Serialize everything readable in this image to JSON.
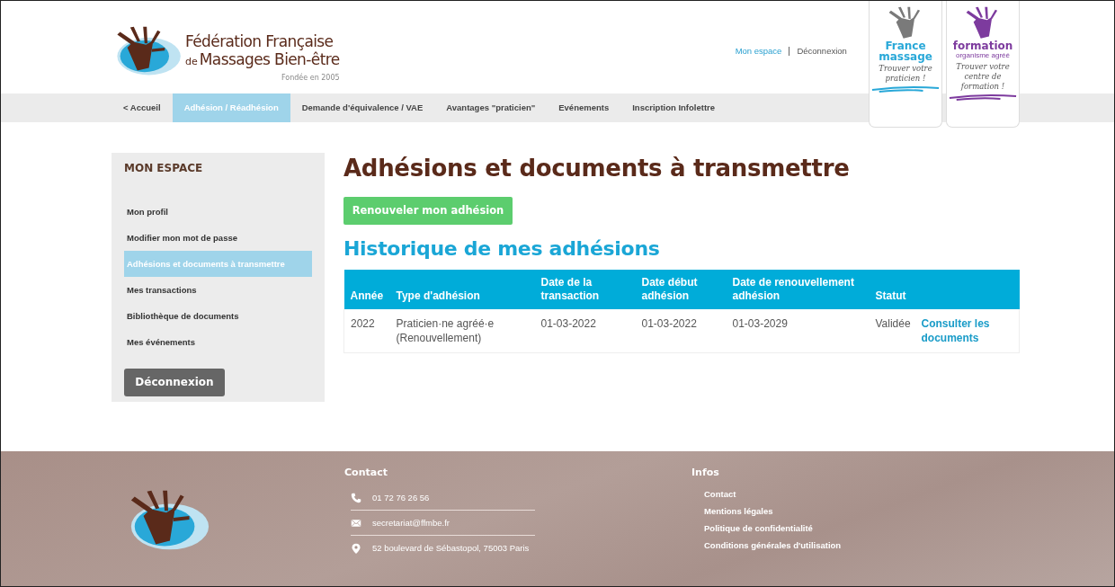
{
  "header": {
    "logo": {
      "line_1": "Fédération Française",
      "line_2_prefix": "de",
      "line_2": "Massages Bien-être",
      "tagline": "Fondée en 2005"
    },
    "user_links": [
      {
        "label": "Mon espace",
        "selected": true
      },
      {
        "label": "Déconnexion",
        "selected": false
      }
    ],
    "promo_cards": [
      {
        "title": "France",
        "title_2": "massage",
        "slogan": "Trouver votre praticien !",
        "color": "#29a8d8"
      },
      {
        "title": "formation",
        "subtitle": "organisme agréé",
        "slogan": "Trouver votre centre de formation !",
        "color": "#7d3b9e"
      }
    ]
  },
  "nav": {
    "items": [
      {
        "label": "< Accueil",
        "selected": false
      },
      {
        "label": "Adhésion / Réadhésion",
        "selected": true
      },
      {
        "label": "Demande d'équivalence / VAE",
        "selected": false
      },
      {
        "label": "Avantages \"praticien\"",
        "selected": false
      },
      {
        "label": "Evénements",
        "selected": false
      },
      {
        "label": "Inscription Infolettre",
        "selected": false
      }
    ]
  },
  "sidebar": {
    "title": "MON ESPACE",
    "items": [
      {
        "label": "Mon profil",
        "selected": false
      },
      {
        "label": "Modifier mon mot de passe",
        "selected": false
      },
      {
        "label": "Adhésions et documents à transmettre",
        "selected": true
      },
      {
        "label": "Mes transactions",
        "selected": false
      },
      {
        "label": "Bibliothèque de documents",
        "selected": false
      },
      {
        "label": "Mes événements",
        "selected": false
      }
    ],
    "logout_button": "Déconnexion"
  },
  "main": {
    "title": "Adhésions et documents à transmettre",
    "renew_button": "Renouveler mon adhésion",
    "history_title": "Historique de mes adhésions",
    "table": {
      "columns": [
        "Année",
        "Type d'adhésion",
        "Date de la transaction",
        "Date début adhésion",
        "Date de renouvellement adhésion",
        "Statut"
      ],
      "rows": [
        {
          "cells": [
            "2022",
            "Praticien·ne agréé·e (Renouvellement)",
            "01-03-2022",
            "01-03-2022",
            "01-03-2029",
            "Validée"
          ],
          "link": "Consulter les documents"
        }
      ]
    }
  },
  "footer": {
    "contact": {
      "title": "Contact",
      "items": [
        {
          "kind": "phone",
          "text": "01 72 76 26 56"
        },
        {
          "kind": "email",
          "text": "secretariat@ffmbe.fr"
        },
        {
          "kind": "location",
          "text": "52 boulevard de Sébastopol, 75003 Paris"
        }
      ]
    },
    "infos": {
      "title": "Infos",
      "links": [
        "Contact",
        "Mentions légales",
        "Politique de confidentialité",
        "Conditions générales d'utilisation"
      ]
    }
  }
}
